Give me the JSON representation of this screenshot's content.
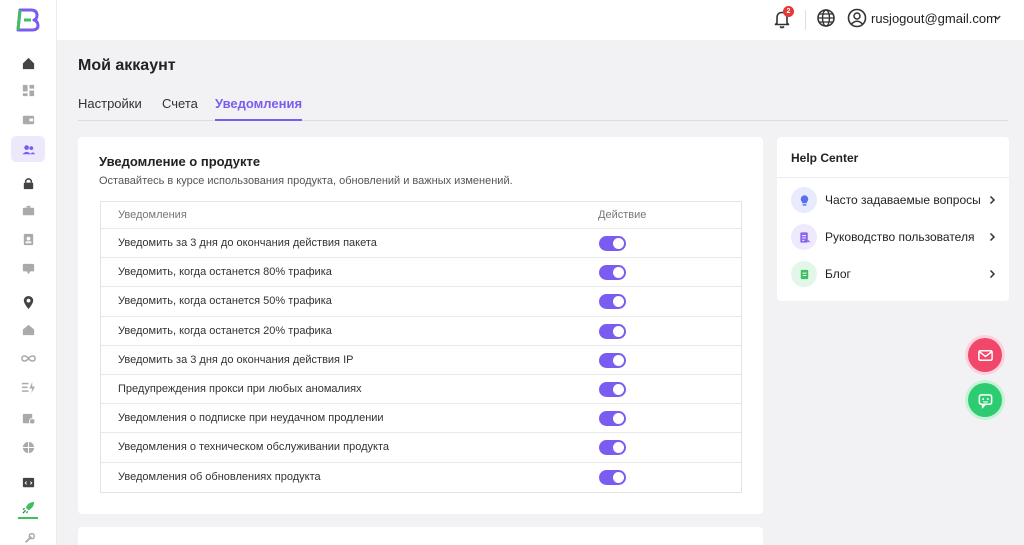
{
  "colors": {
    "accent": "#7b5cf0",
    "logo_green": "#3fbf60",
    "badge": "#e53935",
    "mail_fab": "#f0476b",
    "chat_fab": "#2ecc71"
  },
  "sidebar": {
    "icons": [
      "logo",
      "home-icon",
      "dashboard-icon",
      "wallet-icon",
      "users-icon",
      "lock-icon",
      "briefcase-icon",
      "id-card-icon",
      "chat-box-icon",
      "location-pin-icon",
      "house-icon",
      "infinity-icon",
      "bolt-list-icon",
      "calendar-list-icon",
      "globe-grid-icon",
      "code-window-icon",
      "rocket-icon",
      "link-icon"
    ]
  },
  "header": {
    "notification_count": "2",
    "user_email": "rusjogout@gmail.com"
  },
  "page": {
    "title": "Мой аккаунт",
    "tabs": [
      {
        "label": "Настройки"
      },
      {
        "label": "Счета"
      },
      {
        "label": "Уведомления",
        "active": true
      }
    ]
  },
  "notifications": {
    "title": "Уведомление о продукте",
    "subtitle": "Оставайтесь в курсе использования продукта, обновлений и важных изменений.",
    "col_name": "Уведомления",
    "col_action": "Действие",
    "rows": [
      {
        "label": "Уведомить за 3 дня до окончания действия пакета",
        "enabled": true
      },
      {
        "label": "Уведомить, когда останется 80% трафика",
        "enabled": true
      },
      {
        "label": "Уведомить, когда останется 50% трафика",
        "enabled": true
      },
      {
        "label": "Уведомить, когда останется 20% трафика",
        "enabled": true
      },
      {
        "label": "Уведомить за 3 дня до окончания действия IP",
        "enabled": true
      },
      {
        "label": "Предупреждения прокси при любых аномалиях",
        "enabled": true
      },
      {
        "label": "Уведомления о подписке при неудачном продлении",
        "enabled": true
      },
      {
        "label": "Уведомления о техническом обслуживании продукта",
        "enabled": true
      },
      {
        "label": "Уведомления об обновлениях продукта",
        "enabled": true
      }
    ]
  },
  "help": {
    "title": "Help Center",
    "items": [
      {
        "label": "Часто задаваемые вопросы",
        "icon": "lightbulb-icon"
      },
      {
        "label": "Руководство пользователя",
        "icon": "guide-icon"
      },
      {
        "label": "Блог",
        "icon": "blog-icon"
      }
    ]
  }
}
